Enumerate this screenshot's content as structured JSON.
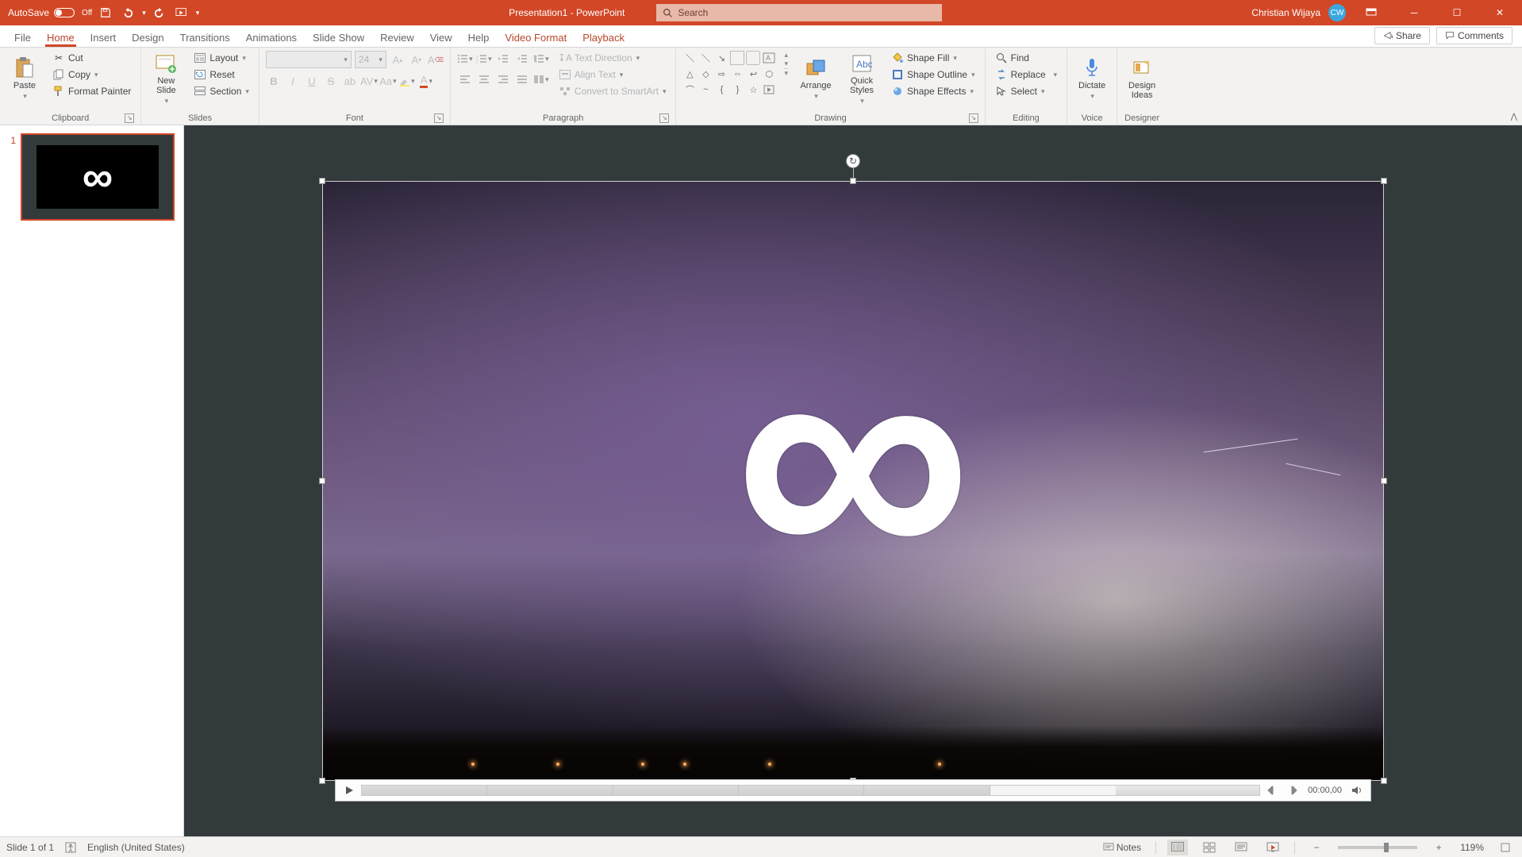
{
  "titlebar": {
    "autosave_label": "AutoSave",
    "autosave_value": "Off",
    "doc_title": "Presentation1 - PowerPoint",
    "search_placeholder": "Search",
    "user_name": "Christian Wijaya",
    "user_initials": "CW"
  },
  "tabs": {
    "items": [
      "File",
      "Home",
      "Insert",
      "Design",
      "Transitions",
      "Animations",
      "Slide Show",
      "Review",
      "View",
      "Help",
      "Video Format",
      "Playback"
    ],
    "active": "Home",
    "contextual": [
      "Video Format",
      "Playback"
    ],
    "share": "Share",
    "comments": "Comments"
  },
  "ribbon": {
    "clipboard": {
      "paste": "Paste",
      "cut": "Cut",
      "copy": "Copy",
      "format_painter": "Format Painter",
      "label": "Clipboard"
    },
    "slides": {
      "new_slide": "New\nSlide",
      "layout": "Layout",
      "reset": "Reset",
      "section": "Section",
      "label": "Slides"
    },
    "font": {
      "name_value": "",
      "size_value": "24",
      "label": "Font"
    },
    "paragraph": {
      "text_direction": "Text Direction",
      "align_text": "Align Text",
      "convert_smartart": "Convert to SmartArt",
      "label": "Paragraph"
    },
    "drawing": {
      "arrange": "Arrange",
      "quick_styles": "Quick\nStyles",
      "shape_fill": "Shape Fill",
      "shape_outline": "Shape Outline",
      "shape_effects": "Shape Effects",
      "label": "Drawing"
    },
    "editing": {
      "find": "Find",
      "replace": "Replace",
      "select": "Select",
      "label": "Editing"
    },
    "voice": {
      "dictate": "Dictate",
      "label": "Voice"
    },
    "designer": {
      "design_ideas": "Design\nIdeas",
      "label": "Designer"
    }
  },
  "thumbs": {
    "items": [
      {
        "num": "1"
      }
    ]
  },
  "media": {
    "time": "00:00,00"
  },
  "status": {
    "slide_info": "Slide 1 of 1",
    "language": "English (United States)",
    "notes": "Notes",
    "zoom": "119%"
  }
}
